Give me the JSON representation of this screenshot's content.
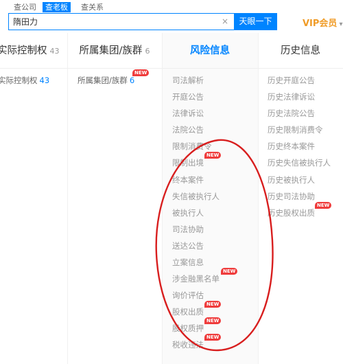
{
  "search": {
    "tabs": [
      {
        "label": "查公司"
      },
      {
        "label": "查老板"
      },
      {
        "label": "查关系"
      }
    ],
    "value": "隋田力",
    "clear_icon": "×",
    "button_label": "天眼一下"
  },
  "vip": {
    "label": "VIP会员",
    "caret": "▾"
  },
  "columns": {
    "actual_control": {
      "label": "实际控制权",
      "count": "43"
    },
    "group": {
      "label": "所属集团/族群",
      "count": "6"
    },
    "risk": {
      "label": "风险信息"
    },
    "history": {
      "label": "历史信息"
    }
  },
  "rows": {
    "actual_control": {
      "label": "实际控制权",
      "count": "43"
    },
    "group": {
      "label": "所属集团/族群",
      "count": "6"
    }
  },
  "badge": {
    "new": "NEW"
  },
  "risk_items": [
    {
      "label": "司法解析"
    },
    {
      "label": "开庭公告"
    },
    {
      "label": "法律诉讼"
    },
    {
      "label": "法院公告"
    },
    {
      "label": "限制消费令"
    },
    {
      "label": "限制出境"
    },
    {
      "label": "终本案件"
    },
    {
      "label": "失信被执行人"
    },
    {
      "label": "被执行人"
    },
    {
      "label": "司法协助"
    },
    {
      "label": "送达公告"
    },
    {
      "label": "立案信息"
    },
    {
      "label": "涉金融黑名单"
    },
    {
      "label": "询价评估"
    },
    {
      "label": "股权出质"
    },
    {
      "label": "股权质押"
    },
    {
      "label": "税收违法"
    }
  ],
  "history_items": [
    {
      "label": "历史开庭公告"
    },
    {
      "label": "历史法律诉讼"
    },
    {
      "label": "历史法院公告"
    },
    {
      "label": "历史限制消费令"
    },
    {
      "label": "历史终本案件"
    },
    {
      "label": "历史失信被执行人"
    },
    {
      "label": "历史被执行人"
    },
    {
      "label": "历史司法协助"
    },
    {
      "label": "历史股权出质"
    }
  ],
  "colors": {
    "accent": "#0084ff",
    "badge": "#ef3b3b",
    "vip": "#f09c28",
    "annotation": "#d81e1e"
  }
}
